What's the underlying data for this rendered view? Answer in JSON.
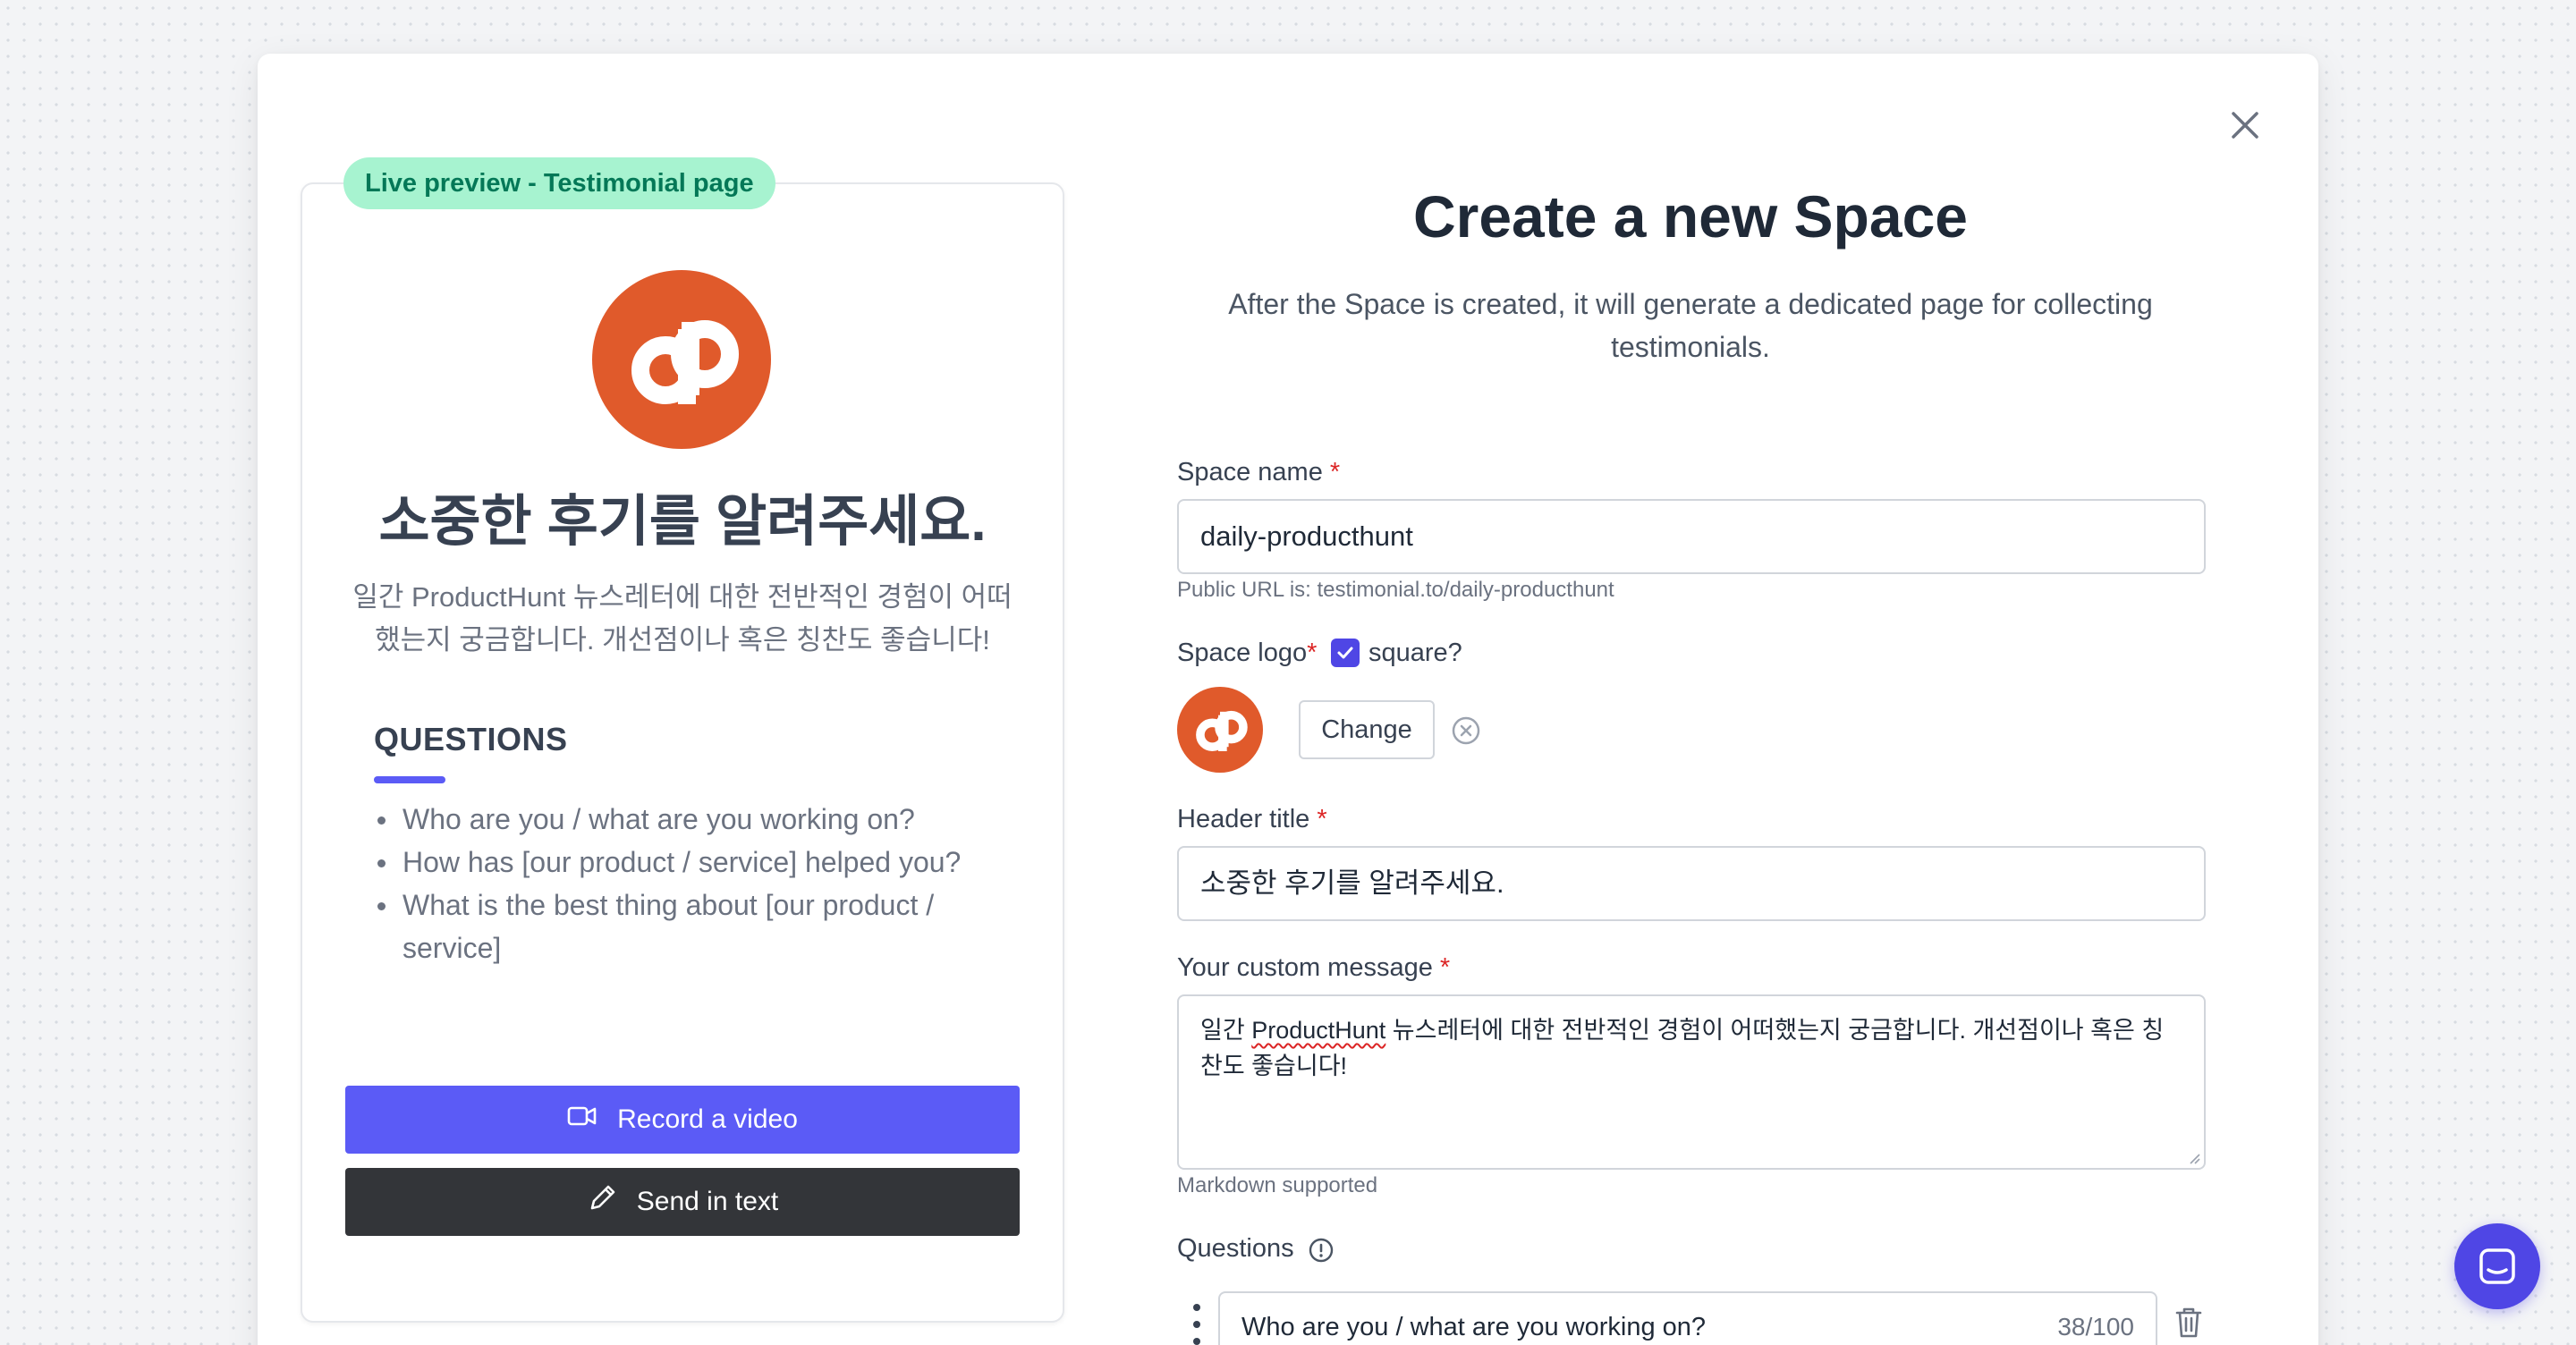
{
  "preview": {
    "badge": "Live preview - Testimonial page",
    "logo_text": "dp",
    "title": "소중한 후기를 알려주세요.",
    "message": "일간 ProductHunt 뉴스레터에 대한 전반적인 경험이 어떠했는지 궁금합니다. 개선점이나 혹은 칭찬도 좋습니다!",
    "questions_heading": "QUESTIONS",
    "questions": [
      "Who are you / what are you working on?",
      "How has [our product / service] helped you?",
      "What is the best thing about [our product / service]"
    ],
    "record_label": "Record a video",
    "send_text_label": "Send in text",
    "brand_color": "#e05a2b",
    "accent_color": "#5b5bf6"
  },
  "form": {
    "title": "Create a new Space",
    "subtitle": "After the Space is created, it will generate a dedicated page for collecting testimonials.",
    "space_name_label": "Space name",
    "space_name_value": "daily-producthunt",
    "public_url_prefix": "Public URL is: testimonial.to/",
    "public_url_slug": "daily-producthunt",
    "space_logo_label": "Space logo",
    "square_label": "square?",
    "square_checked": true,
    "change_label": "Change",
    "header_title_label": "Header title",
    "header_title_value": "소중한 후기를 알려주세요.",
    "custom_message_label": "Your custom message",
    "custom_message_before": "일간 ",
    "custom_message_flagged": "ProductHunt",
    "custom_message_after": " 뉴스레터에 대한 전반적인 경험이 어떠했는지 궁금합니다. 개선점이나 혹은 칭찬도 좋습니다!",
    "markdown_hint": "Markdown supported",
    "questions_label": "Questions",
    "first_question": "Who are you / what are you working on?",
    "first_question_count": "38/100",
    "required_mark": "*"
  },
  "icons": {
    "close": "close-icon",
    "record": "video-camera-icon",
    "send": "pencil-icon",
    "check": "check-icon",
    "remove": "x-circle-icon",
    "info": "info-icon",
    "drag": "drag-handle-icon",
    "trash": "trash-icon",
    "chat": "chat-icon"
  }
}
